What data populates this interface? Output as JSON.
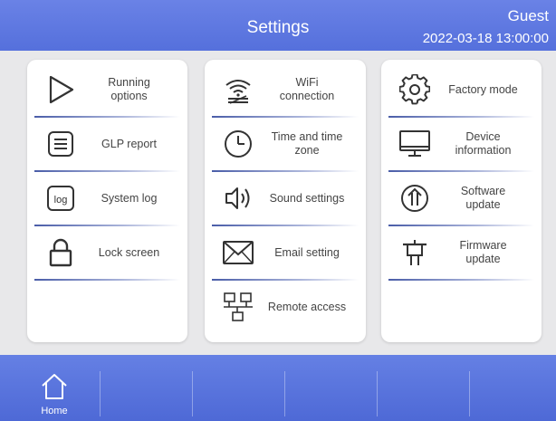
{
  "header": {
    "title": "Settings",
    "user": "Guest",
    "datetime": "2022-03-18 13:00:00"
  },
  "columns": [
    {
      "items": [
        {
          "label": "Running\noptions",
          "icon": "play-icon"
        },
        {
          "label": "GLP report",
          "icon": "report-icon"
        },
        {
          "label": "System log",
          "icon": "log-icon"
        },
        {
          "label": "Lock screen",
          "icon": "lock-icon"
        }
      ]
    },
    {
      "items": [
        {
          "label": "WiFi\nconnection",
          "icon": "wifi-icon"
        },
        {
          "label": "Time and time\nzone",
          "icon": "clock-icon"
        },
        {
          "label": "Sound settings",
          "icon": "speaker-icon"
        },
        {
          "label": "Email setting",
          "icon": "email-icon"
        },
        {
          "label": "Remote access",
          "icon": "network-icon"
        }
      ]
    },
    {
      "items": [
        {
          "label": "Factory mode",
          "icon": "gear-icon"
        },
        {
          "label": "Device\ninformation",
          "icon": "monitor-icon"
        },
        {
          "label": "Software\nupdate",
          "icon": "upload-icon"
        },
        {
          "label": "Firmware\nupdate",
          "icon": "firmware-icon"
        }
      ]
    }
  ],
  "footer": {
    "home_label": "Home"
  },
  "colors": {
    "header": "#5a74de",
    "footer": "#5570dc",
    "background": "#e8e8ea",
    "panel": "#ffffff",
    "text": "#444444"
  }
}
